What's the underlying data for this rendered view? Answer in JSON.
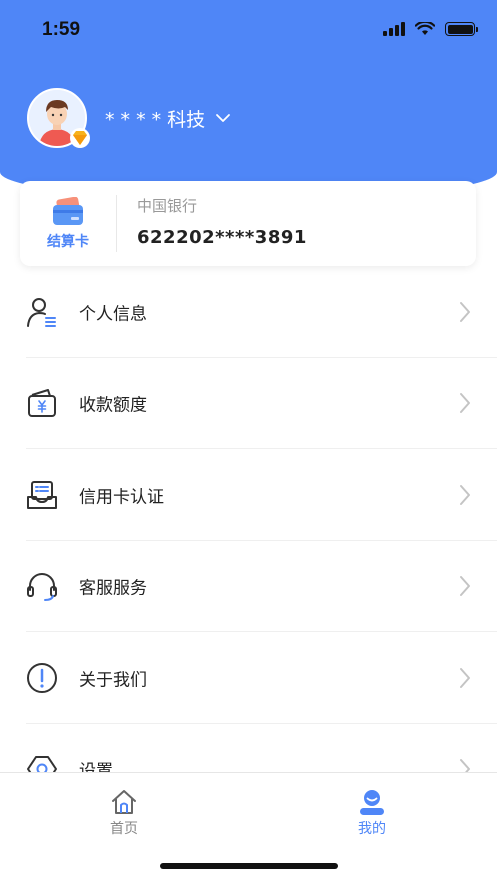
{
  "status_bar": {
    "time": "1:59"
  },
  "profile": {
    "company_name": "* * * *  科技"
  },
  "settlement_card": {
    "label": "结算卡",
    "bank_name": "中国银行",
    "card_number": "622202****3891"
  },
  "menu": {
    "items": [
      {
        "label": "个人信息",
        "icon": "user-info-icon"
      },
      {
        "label": "收款额度",
        "icon": "wallet-yuan-icon"
      },
      {
        "label": "信用卡认证",
        "icon": "credit-card-tray-icon"
      },
      {
        "label": "客服服务",
        "icon": "headset-icon"
      },
      {
        "label": "关于我们",
        "icon": "info-circle-icon"
      },
      {
        "label": "设置",
        "icon": "settings-icon"
      }
    ]
  },
  "tabbar": {
    "tabs": [
      {
        "label": "首页",
        "active": false
      },
      {
        "label": "我的",
        "active": true
      }
    ]
  },
  "colors": {
    "primary": "#4f86f7",
    "tab_inactive": "#888888",
    "text": "#222222"
  }
}
